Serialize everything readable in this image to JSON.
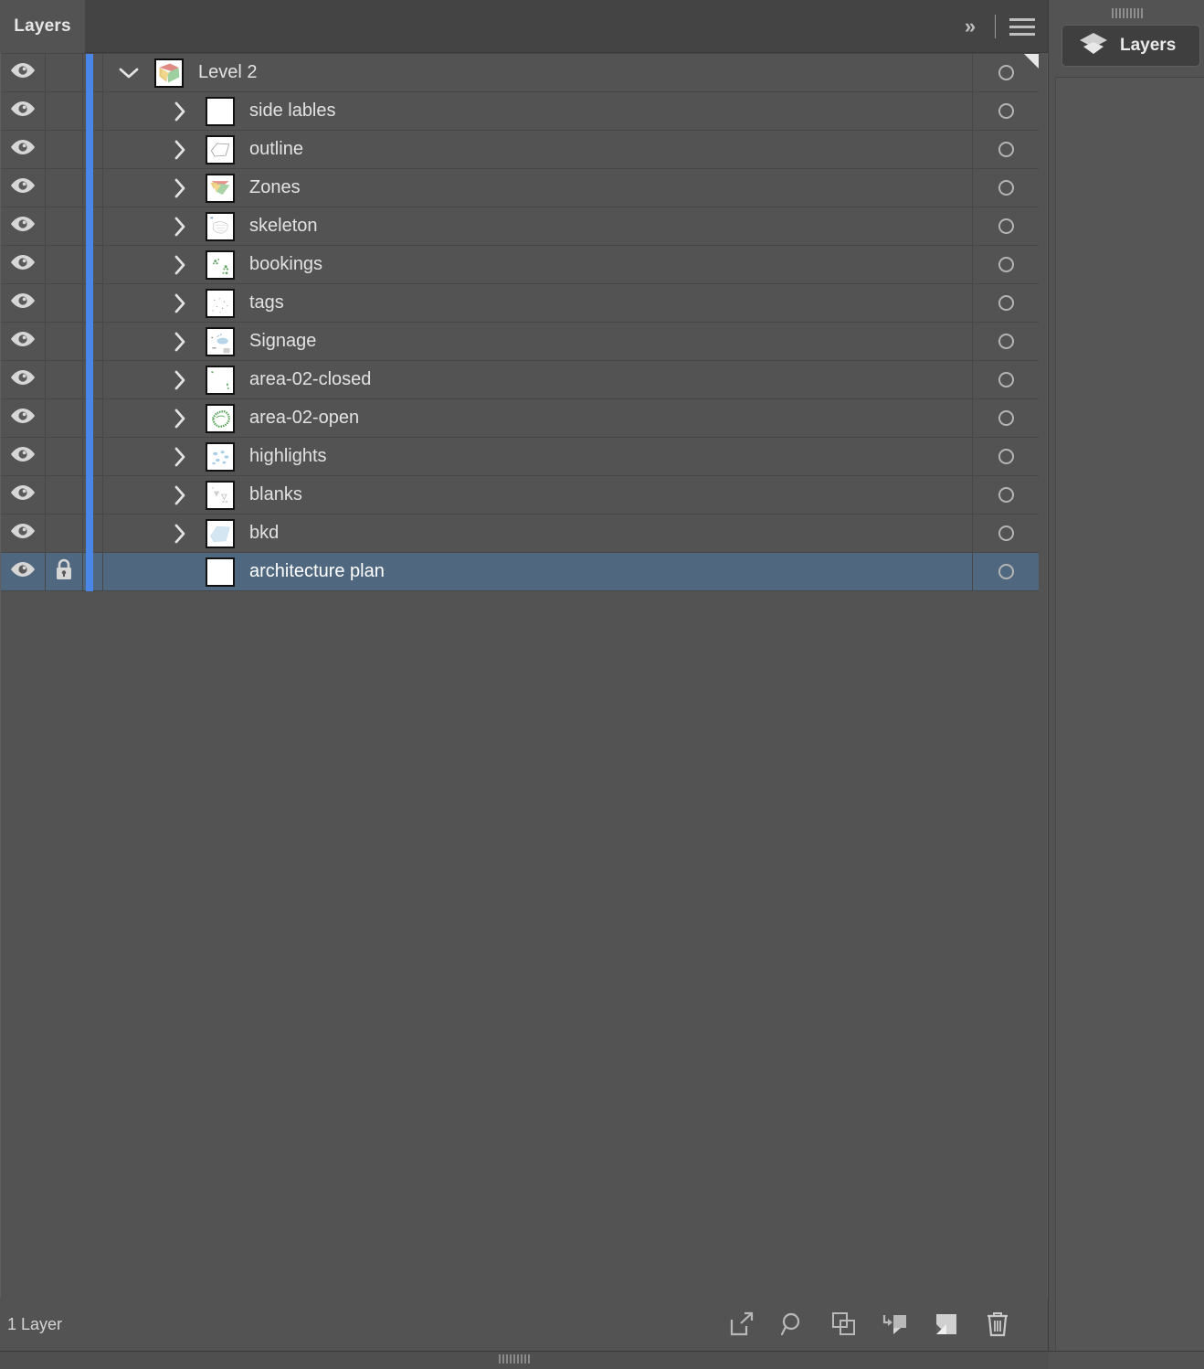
{
  "panel": {
    "tab_label": "Layers",
    "collapse_icon": "double-chevron-right-icon",
    "menu_icon": "hamburger-menu-icon",
    "footer_count": "1 Layer"
  },
  "layers": [
    {
      "name": "Level 2",
      "visible": true,
      "locked": false,
      "selected": false,
      "expanded": true,
      "has_children": true,
      "indent": 0,
      "color": "#4a86e8",
      "thumb": "floorplan-color",
      "target": true,
      "corner_flag": true
    },
    {
      "name": "side lables",
      "visible": true,
      "locked": false,
      "selected": false,
      "expanded": false,
      "has_children": true,
      "indent": 1,
      "color": "#4a86e8",
      "thumb": "sparse-marks",
      "target": true,
      "corner_flag": false
    },
    {
      "name": "outline",
      "visible": true,
      "locked": false,
      "selected": false,
      "expanded": false,
      "has_children": true,
      "indent": 1,
      "color": "#4a86e8",
      "thumb": "outline-shape",
      "target": true,
      "corner_flag": false
    },
    {
      "name": "Zones",
      "visible": true,
      "locked": false,
      "selected": false,
      "expanded": false,
      "has_children": true,
      "indent": 1,
      "color": "#4a86e8",
      "thumb": "zones-color",
      "target": true,
      "corner_flag": false
    },
    {
      "name": "skeleton",
      "visible": true,
      "locked": false,
      "selected": false,
      "expanded": false,
      "has_children": true,
      "indent": 1,
      "color": "#4a86e8",
      "thumb": "skeleton-lines",
      "target": true,
      "corner_flag": false
    },
    {
      "name": "bookings",
      "visible": true,
      "locked": false,
      "selected": false,
      "expanded": false,
      "has_children": true,
      "indent": 1,
      "color": "#4a86e8",
      "thumb": "green-clusters",
      "target": true,
      "corner_flag": false
    },
    {
      "name": "tags",
      "visible": true,
      "locked": false,
      "selected": false,
      "expanded": false,
      "has_children": true,
      "indent": 1,
      "color": "#4a86e8",
      "thumb": "tiny-dots",
      "target": true,
      "corner_flag": false
    },
    {
      "name": "Signage",
      "visible": true,
      "locked": false,
      "selected": false,
      "expanded": false,
      "has_children": true,
      "indent": 1,
      "color": "#4a86e8",
      "thumb": "signage-blue",
      "target": true,
      "corner_flag": false
    },
    {
      "name": "area-02-closed",
      "visible": true,
      "locked": false,
      "selected": false,
      "expanded": false,
      "has_children": true,
      "indent": 1,
      "color": "#4a86e8",
      "thumb": "faint-green",
      "target": true,
      "corner_flag": false
    },
    {
      "name": "area-02-open",
      "visible": true,
      "locked": false,
      "selected": false,
      "expanded": false,
      "has_children": true,
      "indent": 1,
      "color": "#4a86e8",
      "thumb": "green-ring",
      "target": true,
      "corner_flag": false
    },
    {
      "name": "highlights",
      "visible": true,
      "locked": false,
      "selected": false,
      "expanded": false,
      "has_children": true,
      "indent": 1,
      "color": "#4a86e8",
      "thumb": "blue-blobs",
      "target": true,
      "corner_flag": false
    },
    {
      "name": "blanks",
      "visible": true,
      "locked": false,
      "selected": false,
      "expanded": false,
      "has_children": true,
      "indent": 1,
      "color": "#4a86e8",
      "thumb": "grey-marks",
      "target": true,
      "corner_flag": false
    },
    {
      "name": "bkd",
      "visible": true,
      "locked": false,
      "selected": false,
      "expanded": false,
      "has_children": true,
      "indent": 1,
      "color": "#4a86e8",
      "thumb": "blue-slab",
      "target": true,
      "corner_flag": false
    },
    {
      "name": "architecture plan",
      "visible": true,
      "locked": true,
      "selected": true,
      "expanded": false,
      "has_children": false,
      "indent": 1,
      "color": "#4a86e8",
      "thumb": "blank-white",
      "target": true,
      "corner_flag": false
    }
  ],
  "footer_tools": [
    {
      "name": "release-to-layers-icon",
      "label": "Release to Layers"
    },
    {
      "name": "locate-object-icon",
      "label": "Locate Object"
    },
    {
      "name": "make-sublayer-icon",
      "label": "Make/Release Clipping Mask"
    },
    {
      "name": "create-new-sublayer-icon",
      "label": "Create New Sublayer"
    },
    {
      "name": "create-new-layer-icon",
      "label": "Create New Layer"
    },
    {
      "name": "delete-selection-icon",
      "label": "Delete Selection"
    }
  ],
  "dock": {
    "button_label": "Layers",
    "button_icon": "layers-stack-icon"
  },
  "colors": {
    "panel_bg": "#535353",
    "tabbar_bg": "#444444",
    "row_border": "#474747",
    "selected_row": "#50687f",
    "layer_color": "#4a86e8",
    "text": "#e2e2e2"
  }
}
